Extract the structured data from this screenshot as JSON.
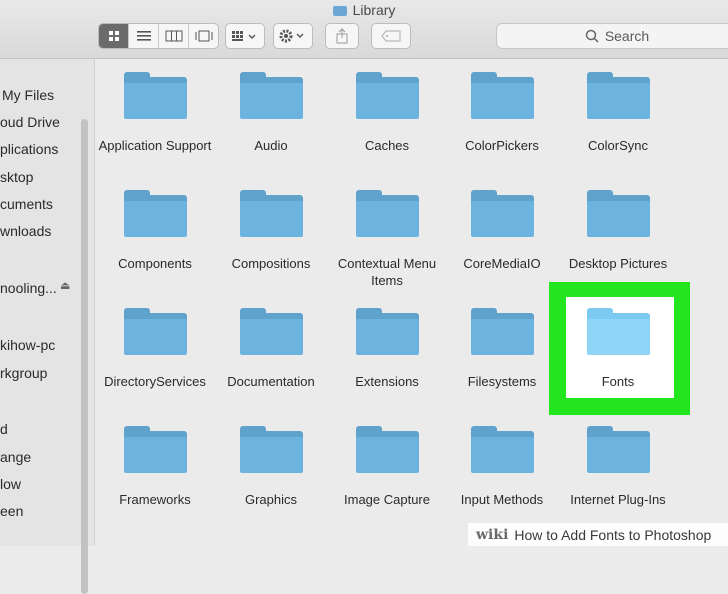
{
  "window": {
    "title": "Library"
  },
  "toolbar": {
    "view_icons": [
      "icon-view-icon",
      "list-view-icon",
      "column-view-icon",
      "gallery-view-icon"
    ],
    "search_placeholder": "Search"
  },
  "sidebar": {
    "items": [
      {
        "label": "My Files"
      },
      {
        "label": "oud Drive"
      },
      {
        "label": "plications"
      },
      {
        "label": "sktop"
      },
      {
        "label": "cuments"
      },
      {
        "label": "wnloads"
      },
      {
        "label": "nooling..."
      },
      {
        "label": "kihow-pc"
      },
      {
        "label": "rkgroup"
      },
      {
        "label": "d"
      },
      {
        "label": "ange"
      },
      {
        "label": "low"
      },
      {
        "label": "een"
      }
    ]
  },
  "folders": [
    "Application Support",
    "Audio",
    "Caches",
    "ColorPickers",
    "ColorSync",
    "Components",
    "Compositions",
    "Contextual Menu Items",
    "CoreMediaIO",
    "Desktop Pictures",
    "DirectoryServices",
    "Documentation",
    "Extensions",
    "Filesystems",
    "Fonts",
    "Frameworks",
    "Graphics",
    "Image Capture",
    "Input Methods",
    "Internet Plug-Ins"
  ],
  "selected_folder": "Fonts",
  "colors": {
    "highlight": "#22e51d",
    "folder": "#6cb4df"
  },
  "watermark": {
    "brand": "wiki",
    "text": "How to Add Fonts to Photoshop"
  }
}
